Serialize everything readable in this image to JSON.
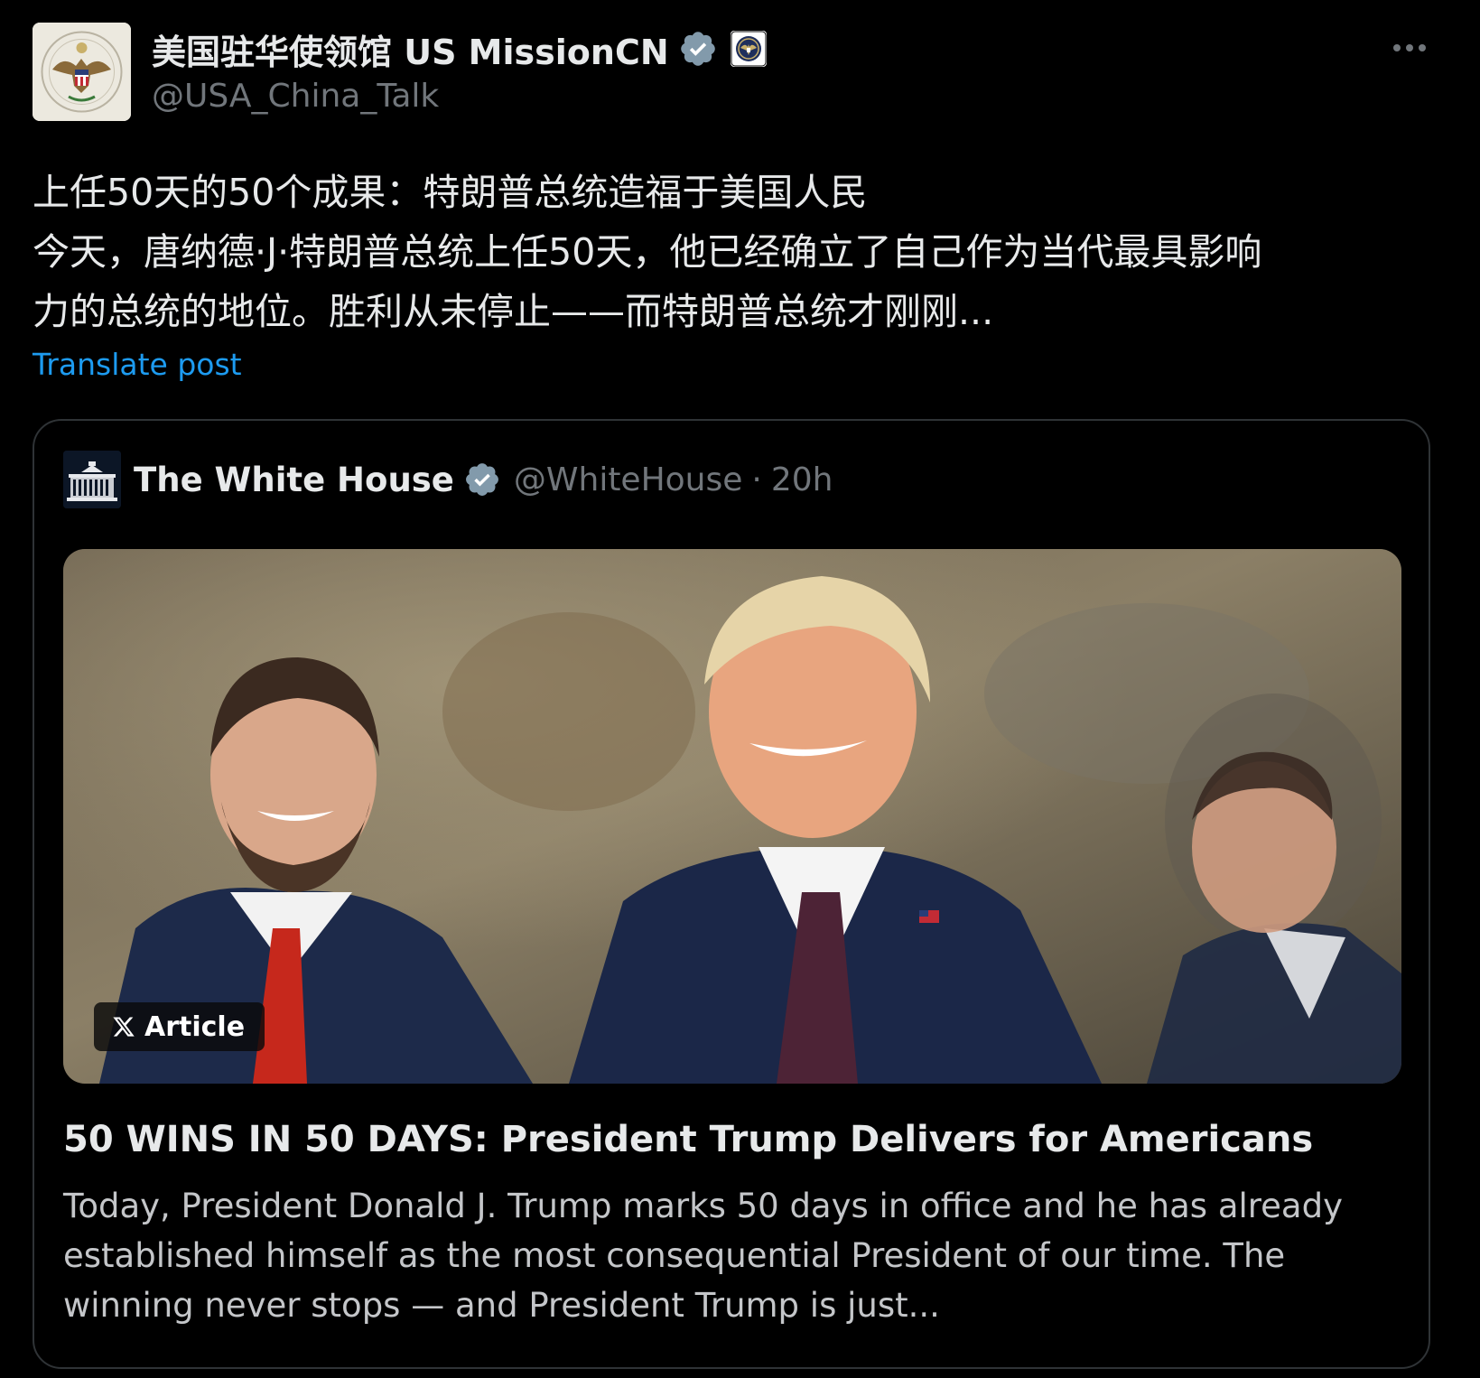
{
  "post": {
    "author": {
      "display_name": "美国驻华使领馆 US MissionCN",
      "handle": "@USA_China_Talk",
      "verified_icon": "verified-badge-icon",
      "affiliation_icon": "government-seal-badge-icon"
    },
    "more_icon": "more-options-icon",
    "text_lines": [
      "上任50天的50个成果：特朗普总统造福于美国人民",
      "今天，唐纳德·J·特朗普总统上任50天，他已经确立了自己作为当代最具影响",
      "力的总统的地位。胜利从未停止——而特朗普总统才刚刚..."
    ],
    "translate_label": "Translate post",
    "link_color": "#1d9bf0",
    "verified_color": "#829aab"
  },
  "quote": {
    "author": {
      "display_name": "The White House",
      "handle": "@WhiteHouse",
      "separator": "·",
      "time": "20h"
    },
    "image_badge": {
      "icon": "x-logo-icon",
      "label": "Article"
    },
    "article_title": "50 WINS IN 50 DAYS: President Trump Delivers for Americans",
    "article_summary_lines": [
      "Today, President Donald J. Trump marks 50 days in office and he has already",
      "established himself as the most consequential President of our time. The",
      "winning never stops — and President Trump is just..."
    ]
  }
}
